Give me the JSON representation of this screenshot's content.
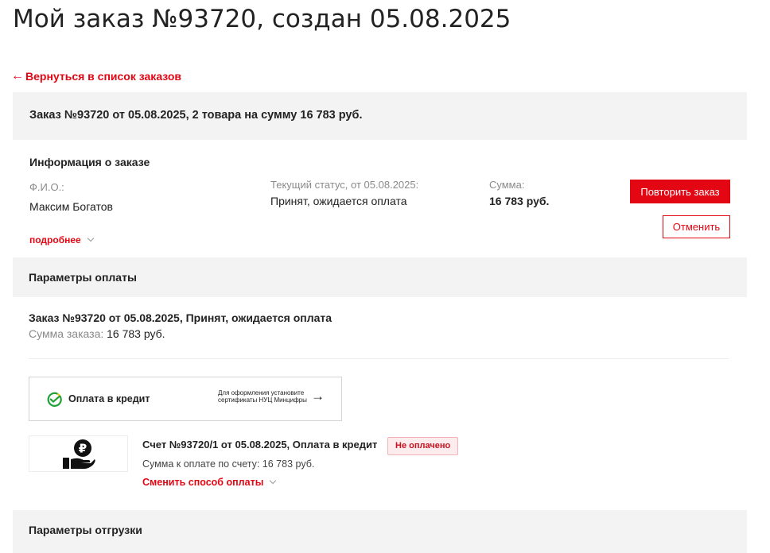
{
  "page": {
    "title": "Мой заказ №93720, создан 05.08.2025",
    "back_link": "Вернуться в список заказов",
    "back_arrow": "←"
  },
  "summary": {
    "text": "Заказ №93720 от 05.08.2025, 2 товара на сумму 16 783 руб."
  },
  "info": {
    "title": "Информация о заказе",
    "fio_label": "Ф.И.О.:",
    "fio_value": "Максим Богатов",
    "status_label": "Текущий статус, от 05.08.2025:",
    "status_value": "Принят, ожидается оплата",
    "sum_label": "Сумма:",
    "sum_value": "16 783 руб.",
    "more_link": "подробнее",
    "repeat_button": "Повторить заказ",
    "cancel_button": "Отменить"
  },
  "payment": {
    "section_title": "Параметры оплаты",
    "order_line": "Заказ №93720 от 05.08.2025, Принят, ожидается оплата",
    "sum_label": "Сумма заказа:",
    "sum_value": "16 783 руб.",
    "credit_label": "Оплата в кредит",
    "credit_note": "Для оформления установите сертификаты НУЦ Минцифры",
    "bill_title": "Счет №93720/1 от 05.08.2025, Оплата в кредит",
    "bill_status": "Не оплачено",
    "bill_sum": "Сумма к оплате по счету: 16 783 руб.",
    "change_method": "Сменить способ оплаты",
    "ruble_symbol": "₽"
  },
  "shipping": {
    "section_title": "Параметры отгрузки"
  },
  "colors": {
    "accent": "#e30613",
    "section_bg": "#f3f3f3",
    "badge_bg": "#fdeced"
  },
  "icons": {
    "credit": "sber-logo-icon",
    "bill": "ruble-hand-icon",
    "chevron": "chevron-down-icon",
    "arrow": "arrow-right-icon"
  }
}
